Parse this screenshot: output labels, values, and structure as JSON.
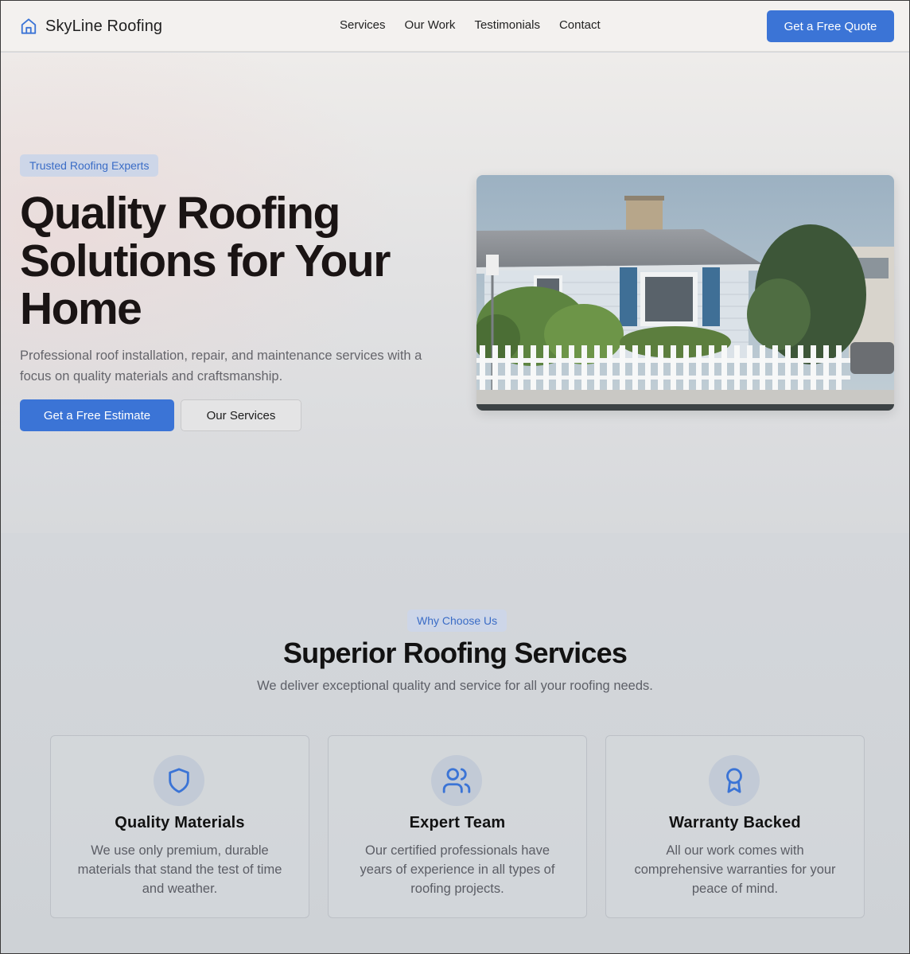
{
  "header": {
    "brand": "SkyLine Roofing",
    "nav": [
      "Services",
      "Our Work",
      "Testimonials",
      "Contact"
    ],
    "cta": "Get a Free Quote"
  },
  "hero": {
    "badge": "Trusted Roofing Experts",
    "title": "Quality Roofing Solutions for Your Home",
    "description": "Professional roof installation, repair, and maintenance services with a focus on quality materials and craftsmanship.",
    "primary_button": "Get a Free Estimate",
    "secondary_button": "Our Services"
  },
  "features": {
    "badge": "Why Choose Us",
    "title": "Superior Roofing Services",
    "description": "We deliver exceptional quality and service for all your roofing needs.",
    "cards": [
      {
        "icon": "shield-icon",
        "title": "Quality Materials",
        "description": "We use only premium, durable materials that stand the test of time and weather."
      },
      {
        "icon": "users-icon",
        "title": "Expert Team",
        "description": "Our certified professionals have years of experience in all types of roofing projects."
      },
      {
        "icon": "award-icon",
        "title": "Warranty Backed",
        "description": "All our work comes with comprehensive warranties for your peace of mind."
      }
    ]
  },
  "colors": {
    "accent": "#3b74d6",
    "badge_bg": "#cdd6e8",
    "heading": "#1a1414"
  }
}
